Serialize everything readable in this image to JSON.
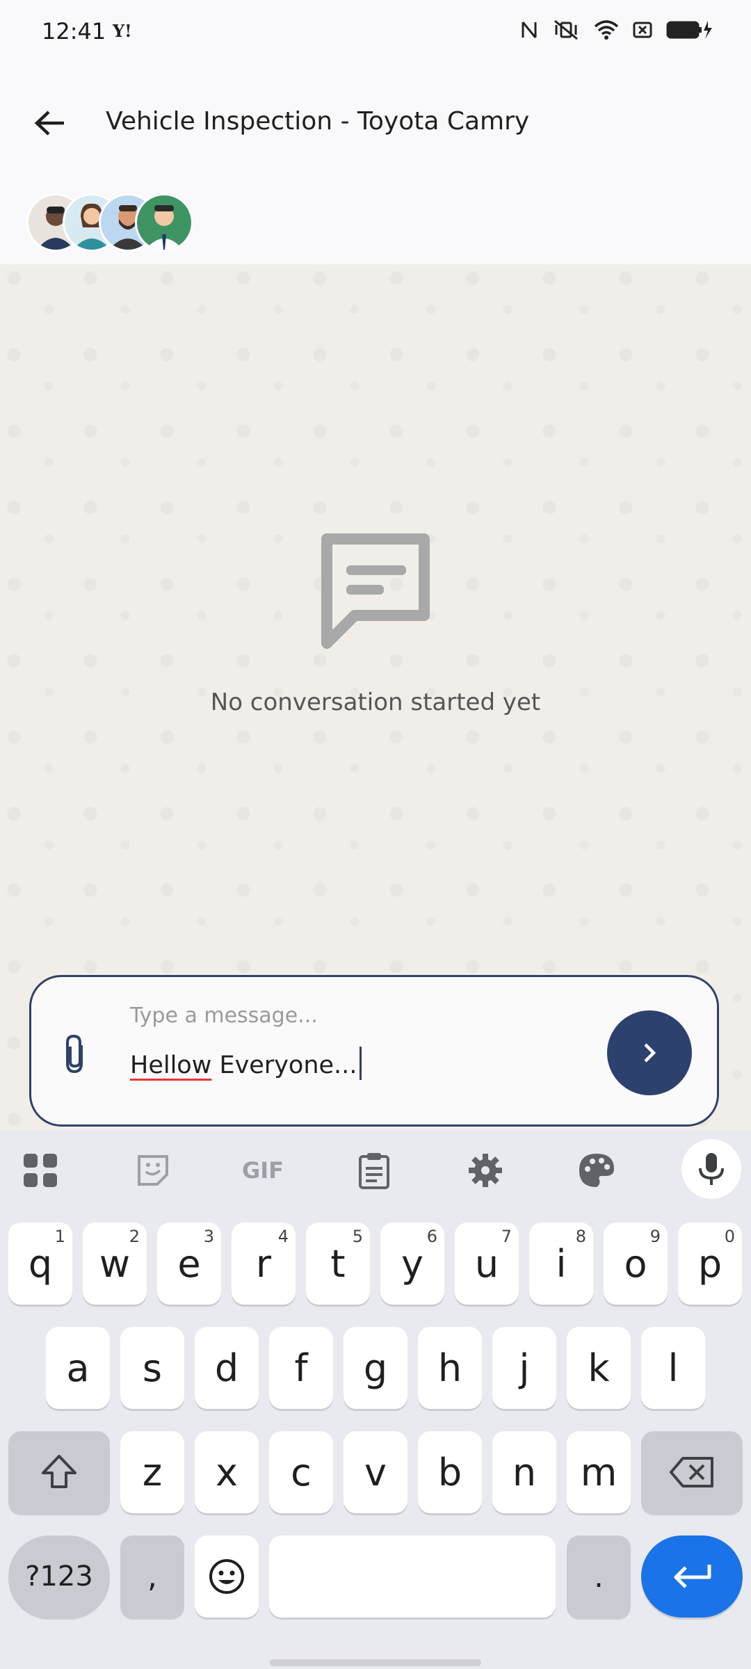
{
  "status_bar": {
    "time": "12:41",
    "app_icon": "Y!"
  },
  "header": {
    "title": "Vehicle Inspection - Toyota Camry",
    "participant_count": 4
  },
  "empty_state": {
    "text": "No conversation started yet"
  },
  "composer": {
    "placeholder": "Type a message...",
    "typed_misspelled": "Hellow",
    "typed_rest": " Everyone..."
  },
  "keyboard": {
    "toolbar": [
      "apps-icon",
      "sticker-icon",
      "gif-icon",
      "clipboard-icon",
      "settings-icon",
      "palette-icon",
      "mic-icon"
    ],
    "gif_label": "GIF",
    "row1": [
      {
        "k": "q",
        "h": "1"
      },
      {
        "k": "w",
        "h": "2"
      },
      {
        "k": "e",
        "h": "3"
      },
      {
        "k": "r",
        "h": "4"
      },
      {
        "k": "t",
        "h": "5"
      },
      {
        "k": "y",
        "h": "6"
      },
      {
        "k": "u",
        "h": "7"
      },
      {
        "k": "i",
        "h": "8"
      },
      {
        "k": "o",
        "h": "9"
      },
      {
        "k": "p",
        "h": "0"
      }
    ],
    "row2": [
      "a",
      "s",
      "d",
      "f",
      "g",
      "h",
      "j",
      "k",
      "l"
    ],
    "row3": [
      "z",
      "x",
      "c",
      "v",
      "b",
      "n",
      "m"
    ],
    "symbols_label": "?123",
    "comma_label": ",",
    "period_label": "."
  },
  "colors": {
    "accent": "#2d416e",
    "enter": "#1a73e8",
    "chat_bg": "#f1eee9"
  }
}
